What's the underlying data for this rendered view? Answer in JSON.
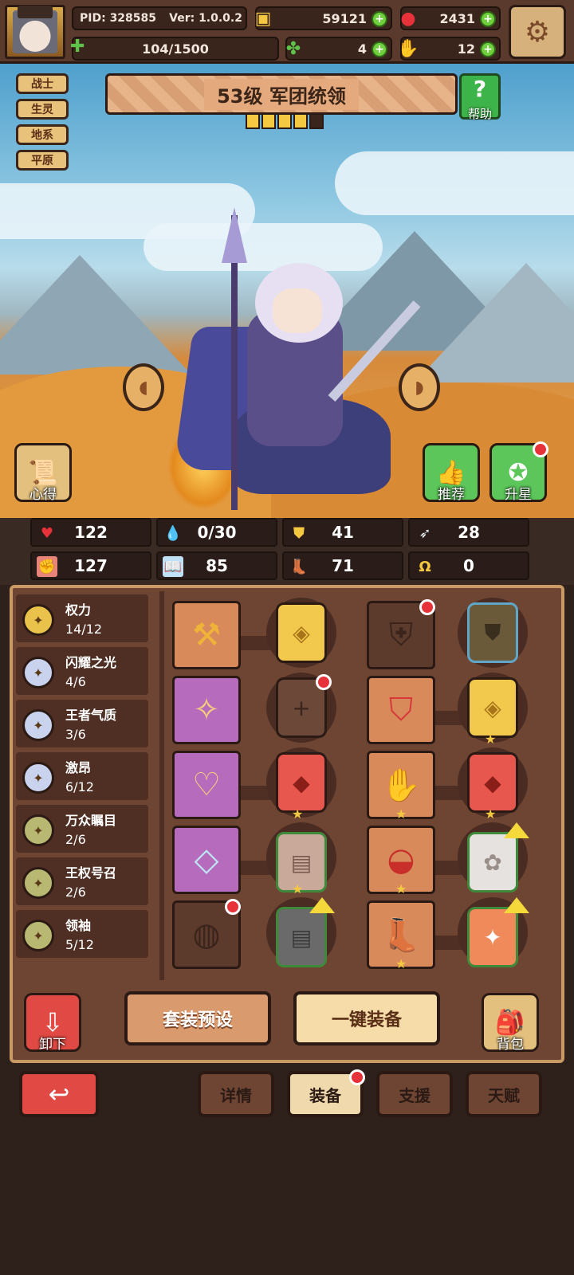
{
  "header": {
    "pid": "PID: 328585",
    "version": "Ver: 1.0.0.2",
    "xp": "104/1500",
    "gold": "59121",
    "ruby": "2431",
    "clover": "4",
    "hand": "12"
  },
  "hero": {
    "title": "53级 军团统领",
    "stars_total": 5,
    "stars_filled": 4,
    "tags": [
      "战士",
      "生灵",
      "地系",
      "平原"
    ]
  },
  "scene_buttons": {
    "help": "帮助",
    "xinde": "心得",
    "tuijian": "推荐",
    "shengxing": "升星"
  },
  "stats": [
    {
      "icon": "heart-icon",
      "value": "122"
    },
    {
      "icon": "droplet-icon",
      "value": "0/30"
    },
    {
      "icon": "shield-icon",
      "value": "41"
    },
    {
      "icon": "wing-icon",
      "value": "28"
    },
    {
      "icon": "fist-icon",
      "value": "127"
    },
    {
      "icon": "book-icon",
      "value": "85"
    },
    {
      "icon": "boot-icon",
      "value": "71"
    },
    {
      "icon": "horseshoe-icon",
      "value": "0"
    }
  ],
  "sets": [
    {
      "name": "权力",
      "count": "14/12",
      "color": "#e8c24a"
    },
    {
      "name": "闪耀之光",
      "count": "4/6",
      "color": "#c9d3ee"
    },
    {
      "name": "王者气质",
      "count": "3/6",
      "color": "#c9d3ee"
    },
    {
      "name": "激昂",
      "count": "6/12",
      "color": "#c9d3ee"
    },
    {
      "name": "万众瞩目",
      "count": "2/6",
      "color": "#b9b872"
    },
    {
      "name": "王权号召",
      "count": "2/6",
      "color": "#b9b872"
    },
    {
      "name": "领袖",
      "count": "5/12",
      "color": "#b9b872"
    }
  ],
  "actions": {
    "unequip": "卸下",
    "preset": "套装预设",
    "equip_all": "一键装备",
    "bag": "背包"
  },
  "nav": {
    "tabs": [
      "详情",
      "装备",
      "支援",
      "天赋"
    ],
    "active": "装备"
  },
  "colors": {
    "brown_dark": "#2b1a14",
    "panel": "#6e4533",
    "accent_gold": "#f5c842",
    "alert_red": "#e8323a",
    "green": "#5cc65a"
  }
}
